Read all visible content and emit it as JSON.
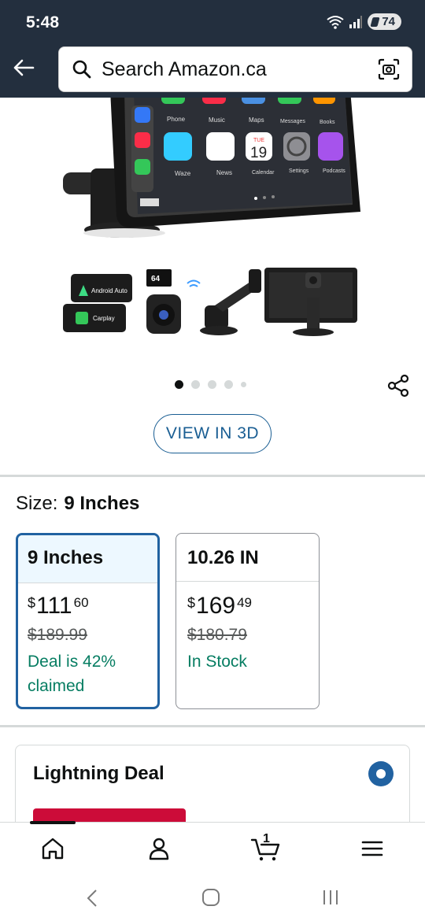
{
  "status_bar": {
    "time": "5:48",
    "battery": "74"
  },
  "header": {
    "search_placeholder": "Search Amazon.ca",
    "icons": [
      "back-arrow-icon",
      "search-icon",
      "camera-scan-icon"
    ]
  },
  "product_images": {
    "hero": {
      "apps": [
        "Phone",
        "Music",
        "Maps",
        "Messages",
        "Books",
        "Waze",
        "News",
        "Calendar",
        "Settings",
        "Podcasts"
      ],
      "calendar_day": "TUE",
      "calendar_date": "19"
    },
    "accessories": {
      "android_label": "Android Auto",
      "carplay_label": "Carplay",
      "sd_label": "64"
    },
    "dot_count": 5,
    "active_dot": 0
  },
  "view_3d": {
    "label": "VIEW IN 3D"
  },
  "size": {
    "label": "Size:",
    "selected": "9 Inches",
    "options": [
      {
        "name": "9 Inches",
        "currency": "$",
        "price_whole": "111",
        "price_cents": "60",
        "list_price": "$189.99",
        "availability": "Deal is 42% claimed",
        "selected": true
      },
      {
        "name": "10.26 IN",
        "currency": "$",
        "price_whole": "169",
        "price_cents": "49",
        "list_price": "$180.79",
        "availability": "In Stock",
        "selected": false
      }
    ]
  },
  "deal": {
    "title": "Lightning Deal",
    "selected": true
  },
  "bottom_nav": {
    "items": [
      "home-icon",
      "account-icon",
      "cart-icon",
      "menu-icon"
    ],
    "cart_count": "1"
  },
  "colors": {
    "header_bg": "#232f3e",
    "link_blue": "#1a5e93",
    "selected_border": "#2162a1",
    "deal_green": "#067d62",
    "deal_red": "#cc0c39"
  }
}
